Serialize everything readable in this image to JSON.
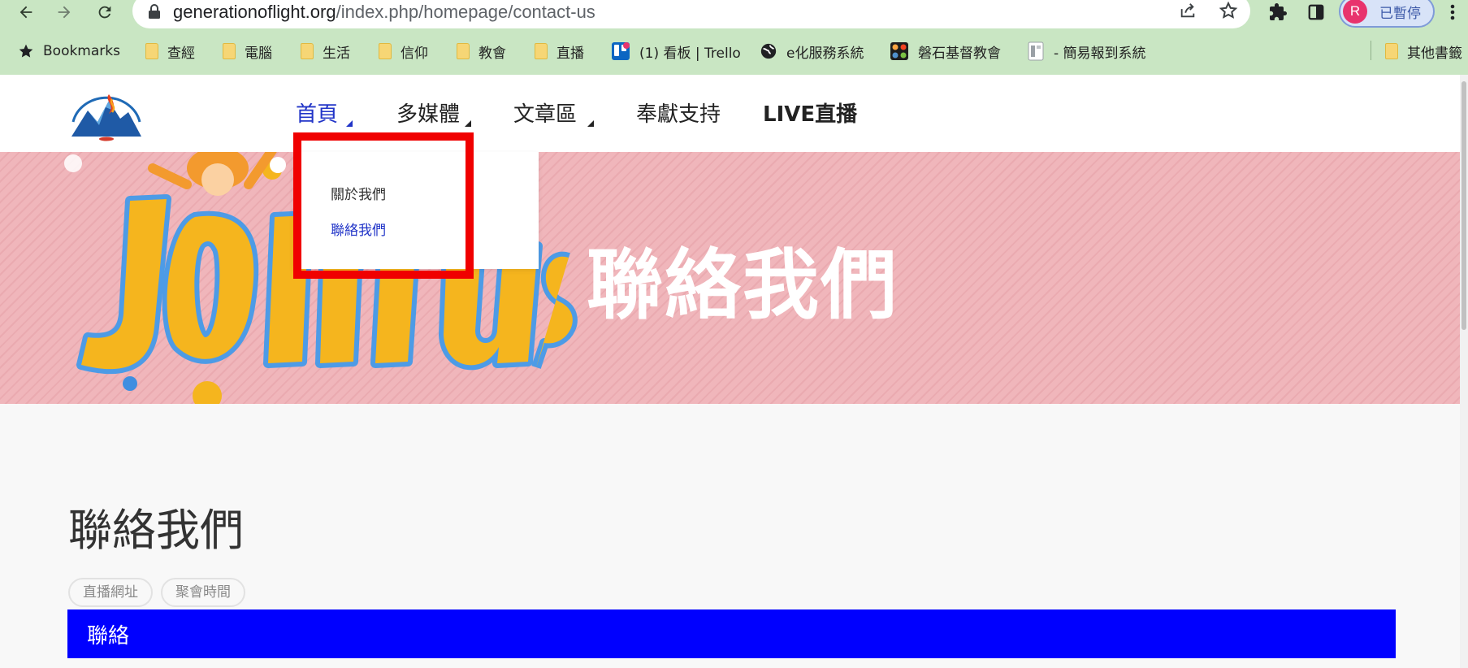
{
  "browser": {
    "url_host": "generationoflight.org",
    "url_path": "/index.php/homepage/contact-us",
    "profile_initial": "R",
    "profile_label": "已暫停"
  },
  "bookmarks": {
    "items": [
      {
        "label": "Bookmarks",
        "icon": "star-icon"
      },
      {
        "label": "查經",
        "icon": "folder-icon"
      },
      {
        "label": "電腦",
        "icon": "folder-icon"
      },
      {
        "label": "生活",
        "icon": "folder-icon"
      },
      {
        "label": "信仰",
        "icon": "folder-icon"
      },
      {
        "label": "教會",
        "icon": "folder-icon"
      },
      {
        "label": "直播",
        "icon": "folder-icon"
      },
      {
        "label": "(1) 看板 | Trello",
        "icon": "trello-icon"
      },
      {
        "label": "e化服務系統",
        "icon": "globe-icon"
      },
      {
        "label": "磐石基督教會",
        "icon": "joomla-icon"
      },
      {
        "label": "- 簡易報到系統",
        "icon": "doc-icon"
      },
      {
        "label": "其他書籤",
        "icon": "folder-icon"
      }
    ]
  },
  "site": {
    "menu": [
      {
        "label": "首頁"
      },
      {
        "label": "多媒體"
      },
      {
        "label": "文章區"
      },
      {
        "label": "奉獻支持"
      },
      {
        "label": "LIVE直播"
      }
    ],
    "dropdown": [
      {
        "label": "關於我們"
      },
      {
        "label": "聯絡我們"
      }
    ]
  },
  "hero": {
    "title": "聯絡我們"
  },
  "content": {
    "heading": "聯絡我們",
    "tags": [
      {
        "label": "直播網址"
      },
      {
        "label": "聚會時間"
      }
    ],
    "bar_label": "聯絡"
  },
  "colors": {
    "accent_blue": "#2235c8",
    "bar_blue": "#0000ff",
    "highlight_red": "#f00000",
    "chrome_green": "#c9e6c3",
    "hero_pink": "#f0b6bb"
  }
}
